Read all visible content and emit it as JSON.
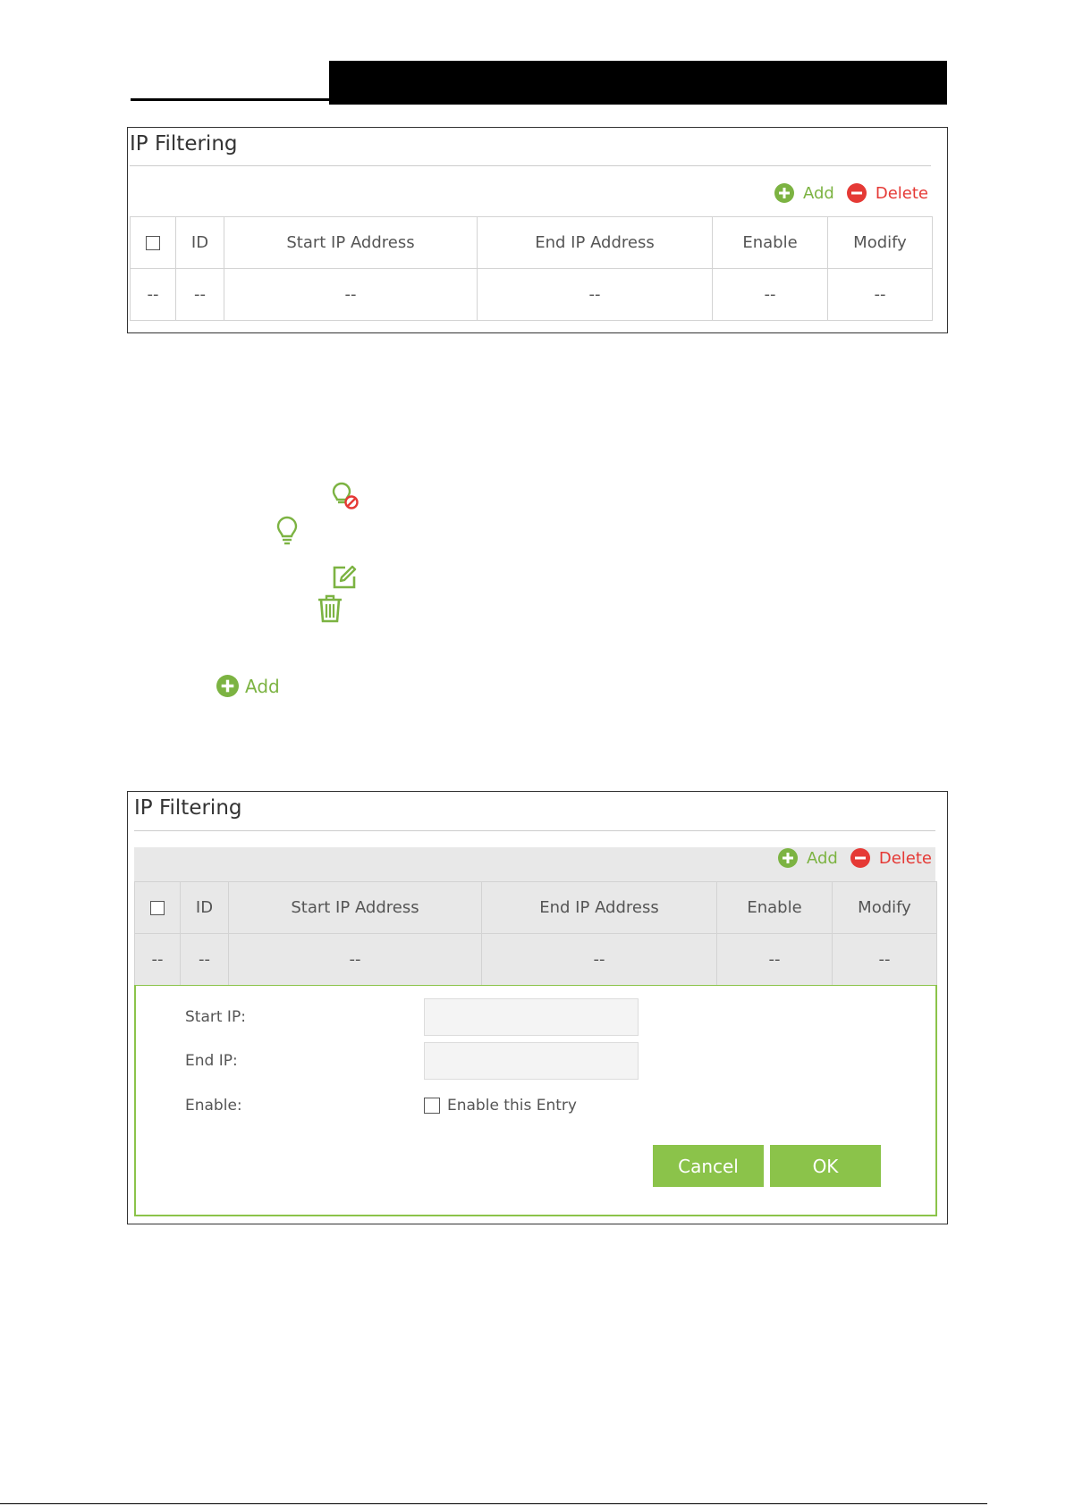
{
  "panel1": {
    "title": "IP Filtering",
    "add_label": "Add",
    "delete_label": "Delete",
    "columns": [
      "ID",
      "Start IP Address",
      "End IP Address",
      "Enable",
      "Modify"
    ],
    "row": [
      "--",
      "--",
      "--",
      "--",
      "--",
      "--"
    ]
  },
  "legend": {
    "add_label": "Add"
  },
  "panel2": {
    "title": "IP Filtering",
    "add_label": "Add",
    "delete_label": "Delete",
    "columns": [
      "ID",
      "Start IP Address",
      "End IP Address",
      "Enable",
      "Modify"
    ],
    "row": [
      "--",
      "--",
      "--",
      "--",
      "--",
      "--"
    ],
    "form": {
      "start_ip_label": "Start IP:",
      "end_ip_label": "End IP:",
      "enable_label": "Enable:",
      "enable_entry_label": "Enable this Entry",
      "cancel_label": "Cancel",
      "ok_label": "OK"
    }
  },
  "colors": {
    "accent_green": "#8bc34a",
    "add_green": "#7cb342",
    "delete_red": "#e53935"
  },
  "icons": [
    "add-icon",
    "delete-icon",
    "bulb-disabled-icon",
    "bulb-icon",
    "edit-icon",
    "trash-icon"
  ]
}
